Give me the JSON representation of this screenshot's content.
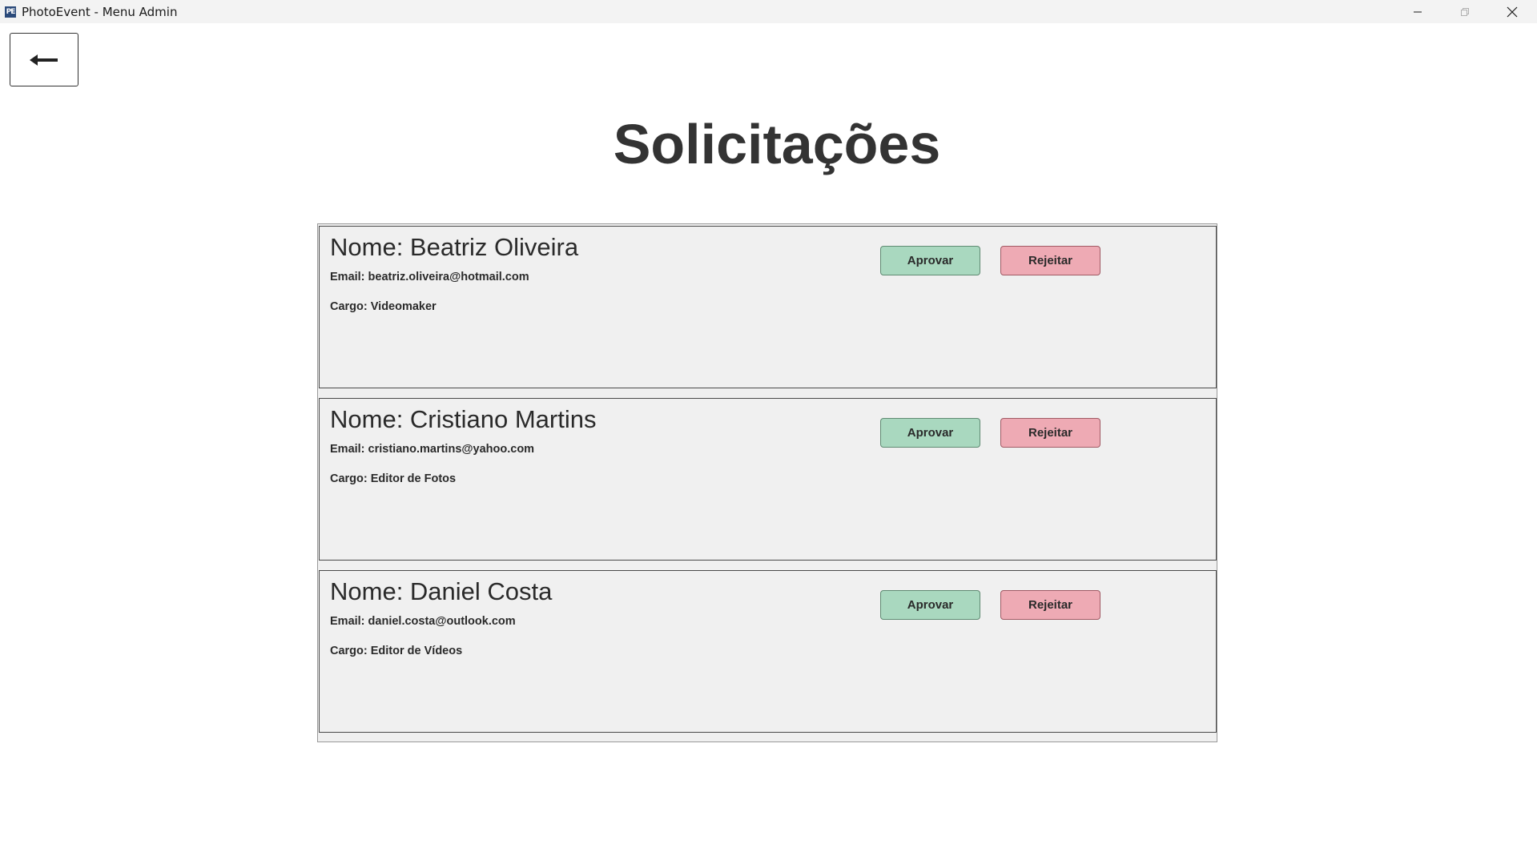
{
  "window": {
    "icon_text": "PE",
    "title": "PhotoEvent - Menu Admin"
  },
  "icons": {
    "app": "app-logo-icon",
    "minimize": "minimize-icon",
    "maximize": "maximize-icon",
    "close": "close-icon",
    "back": "arrow-left-icon"
  },
  "page": {
    "title": "Solicitações"
  },
  "requests": [
    {
      "name": "Nome: Beatriz Oliveira",
      "email": "Email: beatriz.oliveira@hotmail.com",
      "cargo": "Cargo: Videomaker",
      "approve_label": "Aprovar",
      "reject_label": "Rejeitar"
    },
    {
      "name": "Nome: Cristiano Martins",
      "email": "Email: cristiano.martins@yahoo.com",
      "cargo": "Cargo: Editor de Fotos",
      "approve_label": "Aprovar",
      "reject_label": "Rejeitar"
    },
    {
      "name": "Nome: Daniel Costa",
      "email": "Email: daniel.costa@outlook.com",
      "cargo": "Cargo: Editor de Vídeos",
      "approve_label": "Aprovar",
      "reject_label": "Rejeitar"
    }
  ],
  "colors": {
    "approve": "#a9d8bf",
    "reject": "#eeaab4",
    "heading": "#333333"
  }
}
